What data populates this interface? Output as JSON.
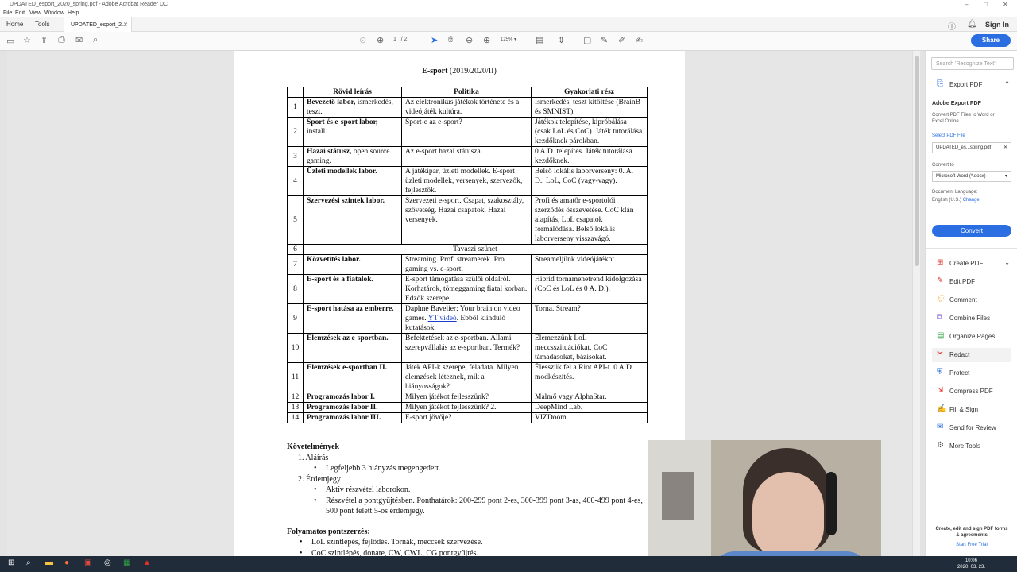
{
  "window": {
    "title": "UPDATED_esport_2020_spring.pdf - Adobe Acrobat Reader DC"
  },
  "menu": [
    "File",
    "Edit",
    "View",
    "Window",
    "Help"
  ],
  "tabs": {
    "home": "Home",
    "tools": "Tools",
    "document": "UPDATED_esport_2..."
  },
  "account": {
    "signin": "Sign In",
    "share": "Share"
  },
  "toolbar": {
    "page_current": "1",
    "page_total": "/ 2",
    "zoom": "125%"
  },
  "document": {
    "title_bold": "E-sport",
    "title_rest": " (2019/2020/II)",
    "headers": [
      "Rövid leírás",
      "Politika",
      "Gyakorlati rész"
    ],
    "rows": [
      {
        "n": "1",
        "a": "Bevezető labor,",
        "a2": "ismerkedés, teszt.",
        "b": "Az elektronikus játékok története és a videójáték kultúra.",
        "c": "Ismerkedés, teszt kitöltése (BrainB és SMNIST)."
      },
      {
        "n": "2",
        "a": "Sport és e-sport labor,",
        "a2": "install.",
        "b": "Sport-e az e-sport?",
        "c": "Játékok telepítése, kipróbálása (csak LoL és CoC). Játék tutorálása kezdőknek párokban."
      },
      {
        "n": "3",
        "a": "Hazai státusz,",
        "a2": "open source gaming.",
        "b": "Az e-sport hazai státusza.",
        "c": "0 A.D. telepítés. Játék tutorálása kezdőknek."
      },
      {
        "n": "4",
        "a": "Üzleti modellek labor.",
        "a2": "",
        "b": "A játékipar, üzleti modellek. E-sport üzleti modellek, versenyek, szervezők, fejlesztők.",
        "c": "Belső lokális laborverseny: 0. A. D., LoL, CoC (vagy-vagy)."
      },
      {
        "n": "5",
        "a": "Szervezési szintek labor.",
        "a2": "",
        "b": "Szervezeti e-sport. Csapat, szakosztály, szövetség. Hazai csapatok. Hazai versenyek.",
        "c": "Profi és amatőr e-sportolói szerződés összevetése. CoC klán alapítás, LoL csapatok formálódása. Belső lokális laborverseny visszavágó."
      },
      {
        "n": "7",
        "a": "Közvetítés labor.",
        "a2": "",
        "b": "Streaming. Profi streamerek. Pro gaming vs. e-sport.",
        "c": "Streameljünk videójátékot."
      },
      {
        "n": "8",
        "a": "E-sport és a fiatalok.",
        "a2": "",
        "b": "E-sport támogatása szülői oldalról. Korhatárok, tömeggaming fiatal korban. Edzők szerepe.",
        "c": "Hibrid tornamenetrend kidolgozása (CoC és LoL és 0 A. D.)."
      },
      {
        "n": "9",
        "a": "E-sport hatása az emberre.",
        "a2": "",
        "b": "Daphne Bavelier: Your brain on video games.",
        "blink": "YT videó",
        "bafter": ". Ebből kiinduló kutatások.",
        "c": "Torna. Stream?"
      },
      {
        "n": "10",
        "a": "Elemzések az e-sportban.",
        "a2": "",
        "b": "Befektetések az e-sportban. Állami szerepvállalás az e-sportban. Termék?",
        "c": "Elemezzünk LoL meccsszituációkat, CoC támadásokat, bázisokat."
      },
      {
        "n": "11",
        "a": "Elemzések e-sportban II.",
        "a2": "",
        "b": "Játék API-k szerepe, feladata. Milyen elemzések léteznek, mik a hiányosságok?",
        "c": "Élesszük fel a Riot API-t. 0 A.D. modkészítés."
      },
      {
        "n": "12",
        "a": "Programozás labor I.",
        "a2": "",
        "b": "Milyen játékot fejlesszünk?",
        "c": "Malmő vagy AlphaStar."
      },
      {
        "n": "13",
        "a": "Programozás labor II.",
        "a2": "",
        "b": "Milyen játékot fejlesszünk? 2.",
        "c": "DeepMind Lab."
      },
      {
        "n": "14",
        "a": "Programozás labor III.",
        "a2": "",
        "b": "E-sport jövője?",
        "c": "VIZDoom."
      }
    ],
    "break_row": {
      "n": "6",
      "text": "Tavaszi szünet"
    },
    "req_heading": "Követelmények",
    "req_1": "1.   Aláírás",
    "req_1a": "Legfeljebb 3 hiányzás megengedett.",
    "req_2": "2.   Érdemjegy",
    "req_2a": "Aktív részvétel laborokon.",
    "req_2b": "Részvétel a pontgyűjtésben. Ponthatárok: 200-299 pont 2-es, 300-399 pont 3-as, 400-499 pont 4-es, 500 pont felett 5-ös érdemjegy.",
    "cont_heading": "Folyamatos pontszerzés:",
    "cont_1": "LoL szintlépés, fejlődés. Tornák, meccsek szervezése.",
    "cont_2": "CoC szintlépés, donate, CW, CWL, CG pontgyűjtés."
  },
  "right_panel": {
    "search_placeholder": "Search 'Recognize Text'",
    "export_title": "Export PDF",
    "adobe_export": "Adobe Export PDF",
    "export_desc": "Convert PDF Files to Word or Excel Online",
    "select_pdf": "Select PDF File",
    "selected_file": "UPDATED_es...spring.pdf",
    "convert_to": "Convert to",
    "convert_format": "Microsoft Word (*.docx)",
    "doc_lang": "Document Language:",
    "lang_value": "English (U.S.)",
    "change": "Change",
    "convert_btn": "Convert",
    "tools": [
      "Create PDF",
      "Edit PDF",
      "Comment",
      "Combine Files",
      "Organize Pages",
      "Redact",
      "Protect",
      "Compress PDF",
      "Fill & Sign",
      "Send for Review",
      "More Tools"
    ],
    "promo": "Create, edit and sign PDF forms & agreements",
    "trial": "Start Free Trial"
  },
  "taskbar": {
    "time": "10:06",
    "date": "2020. 03. 23."
  }
}
